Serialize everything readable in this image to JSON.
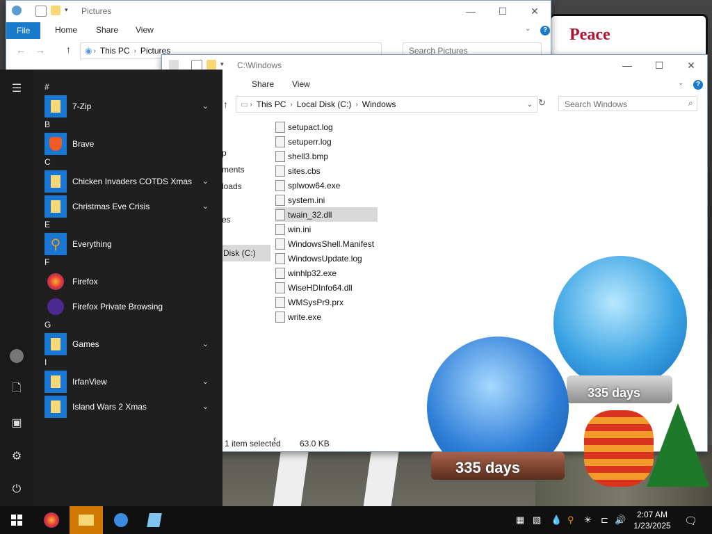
{
  "desktop": {
    "poster_text": "Peace",
    "globe_small_days": "335 days",
    "globe_large_days": "335 days"
  },
  "pictures_window": {
    "title": "Pictures",
    "tabs": [
      "File",
      "Home",
      "Share",
      "View"
    ],
    "breadcrumb": [
      "This PC",
      "Pictures"
    ],
    "search_placeholder": "Search Pictures"
  },
  "windows_window": {
    "title": "C:\\Windows",
    "tabs": [
      "Share",
      "View"
    ],
    "breadcrumb": [
      "This PC",
      "Local Disk (C:)",
      "Windows"
    ],
    "search_placeholder": "Search Windows",
    "nav_partial": [
      "p",
      "ments",
      "loads",
      "es",
      "Disk (C:)"
    ],
    "files": [
      {
        "name": "setupact.log",
        "icon": "log-file-icon"
      },
      {
        "name": "setuperr.log",
        "icon": "log-file-icon"
      },
      {
        "name": "shell3.bmp",
        "icon": "bitmap-file-icon"
      },
      {
        "name": "sites.cbs",
        "icon": "tree-file-icon"
      },
      {
        "name": "splwow64.exe",
        "icon": "printer-exe-icon"
      },
      {
        "name": "system.ini",
        "icon": "ini-file-icon"
      },
      {
        "name": "twain_32.dll",
        "icon": "dll-file-icon",
        "selected": true
      },
      {
        "name": "win.ini",
        "icon": "ini-file-icon"
      },
      {
        "name": "WindowsShell.Manifest",
        "icon": "manifest-file-icon"
      },
      {
        "name": "WindowsUpdate.log",
        "icon": "log-file-icon"
      },
      {
        "name": "winhlp32.exe",
        "icon": "help-exe-icon"
      },
      {
        "name": "WiseHDInfo64.dll",
        "icon": "dll-file-icon"
      },
      {
        "name": "WMSysPr9.prx",
        "icon": "prx-file-icon"
      },
      {
        "name": "write.exe",
        "icon": "write-exe-icon"
      }
    ],
    "status_selected": "1 item selected",
    "status_size": "63.0 KB"
  },
  "start_menu": {
    "sections": [
      {
        "letter": "#",
        "apps": [
          {
            "name": "7-Zip",
            "tile": "folder",
            "expand": true
          }
        ]
      },
      {
        "letter": "B",
        "apps": [
          {
            "name": "Brave",
            "tile": "brave",
            "expand": false
          }
        ]
      },
      {
        "letter": "C",
        "apps": [
          {
            "name": "Chicken Invaders COTDS Xmas",
            "tile": "folder",
            "expand": true
          },
          {
            "name": "Christmas Eve Crisis",
            "tile": "folder",
            "expand": true
          }
        ]
      },
      {
        "letter": "E",
        "apps": [
          {
            "name": "Everything",
            "tile": "search",
            "expand": false
          }
        ]
      },
      {
        "letter": "F",
        "apps": [
          {
            "name": "Firefox",
            "tile": "firefox",
            "expand": false
          },
          {
            "name": "Firefox Private Browsing",
            "tile": "firefox-private",
            "expand": false
          }
        ]
      },
      {
        "letter": "G",
        "apps": [
          {
            "name": "Games",
            "tile": "folder",
            "expand": true
          }
        ]
      },
      {
        "letter": "I",
        "apps": [
          {
            "name": "IrfanView",
            "tile": "folder",
            "expand": true
          },
          {
            "name": "Island Wars 2 Xmas",
            "tile": "folder",
            "expand": true
          }
        ]
      }
    ]
  },
  "taskbar": {
    "clock_time": "2:07 AM",
    "clock_date": "1/23/2025"
  },
  "colors": {
    "accent": "#1979ca",
    "start_bg": "#1f1f1f",
    "taskbar_bg": "#101010"
  }
}
